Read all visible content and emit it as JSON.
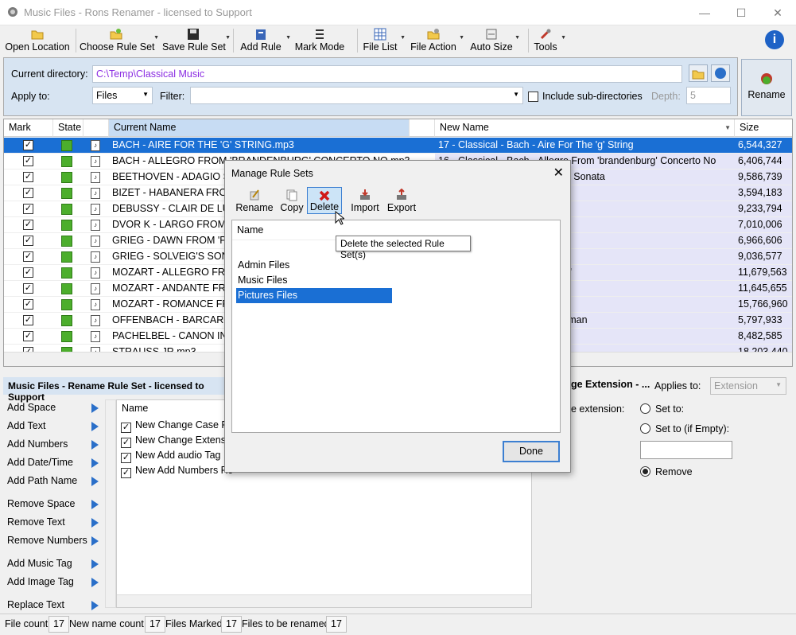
{
  "window": {
    "title": "Music Files - Rons Renamer - licensed to Support",
    "minimize": "—",
    "maximize": "☐",
    "close": "✕"
  },
  "toolbar": {
    "open_location": "Open Location",
    "choose_rule_set": "Choose Rule Set",
    "save_rule_set": "Save Rule Set",
    "add_rule": "Add Rule",
    "mark_mode": "Mark Mode",
    "file_list": "File List",
    "file_action": "File Action",
    "auto_size": "Auto Size",
    "tools": "Tools"
  },
  "top": {
    "current_directory_label": "Current directory:",
    "current_directory": "C:\\Temp\\Classical Music",
    "apply_to_label": "Apply to:",
    "apply_to": "Files",
    "filter_label": "Filter:",
    "filter": "",
    "include_sub_label": "Include sub-directories",
    "depth_label": "Depth:",
    "depth": "5",
    "rename_label": "Rename"
  },
  "grid": {
    "headers": {
      "mark": "Mark",
      "state": "State",
      "current": "Current Name",
      "new": "New Name",
      "size": "Size"
    },
    "rows": [
      {
        "current": "BACH - AIRE FOR THE 'G' STRING.mp3",
        "new": "17 - Classical - Bach - Aire For The 'g' String",
        "size": "6,544,327"
      },
      {
        "current": "BACH - ALLEGRO FROM 'BRANDENBURG' CONCERTO NO.mp3",
        "new": "16 - Classical - Bach - Allegro From 'brandenburg' Concerto No",
        "size": "6,406,744"
      },
      {
        "current": "BEETHOVEN - ADAGIO SOS",
        "new": "gio Sostenuto Form Moonlight Sonata",
        "size": "9,586,739"
      },
      {
        "current": "BIZET - HABANERA FROM '",
        "new": "From 'carmen'",
        "size": "3,594,183"
      },
      {
        "current": "DEBUSSY - CLAIR DE LUNE.",
        "new": "e Lune",
        "size": "9,233,794"
      },
      {
        "current": "DVOR K - LARGO FROM SY",
        "new": "om Symphony No",
        "size": "7,010,006"
      },
      {
        "current": "GRIEG - DAWN FROM 'PEER",
        "new": "m 'peer Gynt'",
        "size": "6,966,606"
      },
      {
        "current": "GRIEG - SOLVEIG'S SONG FR",
        "new": "Song From Peer Gynt",
        "size": "9,036,577"
      },
      {
        "current": "MOZART - ALLEGRO FROM",
        "new": "From 'eine Kleine Nachtmusik'",
        "size": "11,679,563"
      },
      {
        "current": "MOZART - ANDANTE FROM",
        "new": "e From Piano Concerto No",
        "size": "11,645,655"
      },
      {
        "current": "MOZART - ROMANCE FROM",
        "new": "ce From Piano Concerto No",
        "size": "15,766,960"
      },
      {
        "current": "OFFENBACH - BARCAROLL",
        "new": "arolle From The Tales Of Hoffman",
        "size": "5,797,933"
      },
      {
        "current": "PACHELBEL - CANON IN D.",
        "new": "n In D",
        "size": "8,482,585"
      },
      {
        "current": "STRAUSS JR.mp3",
        "new": "",
        "size": "18,203,440"
      }
    ]
  },
  "rules": {
    "title": "Music Files - Rename Rule Set - licensed to Support",
    "buttons": [
      "Add Space",
      "Add Text",
      "Add Numbers",
      "Add Date/Time",
      "Add Path Name",
      "Remove Space",
      "Remove Text",
      "Remove Numbers",
      "Add Music Tag",
      "Add Image Tag",
      "Replace Text"
    ],
    "list_header": "Name",
    "items": [
      "New Change Case Ru",
      "New Change Extensio",
      "New Add audio Tag R",
      "New Add Numbers Ru"
    ],
    "hidden_cols": "Add Numbers",
    "ext_title": "ge Extension - ...",
    "applies_to_label": "Applies to:",
    "applies_to": "Extension",
    "ext_label": "e extension:",
    "set_to": "Set to:",
    "set_to_empty": "Set to (if Empty):",
    "remove": "Remove"
  },
  "status": {
    "file_count_label": "File count",
    "file_count": "17",
    "new_name_label": "New name count",
    "new_name": "17",
    "marked_label": "Files Marked",
    "marked": "17",
    "to_rename_label": "Files to be renamed",
    "to_rename": "17"
  },
  "dialog": {
    "title": "Manage Rule Sets",
    "close": "✕",
    "rename": "Rename",
    "copy": "Copy",
    "delete": "Delete",
    "import": "Import",
    "export": "Export",
    "list_header": "Name",
    "items": [
      "Admin Files",
      "Music Files",
      "Pictures Files"
    ],
    "tooltip": "Delete the selected Rule Set(s)",
    "done": "Done"
  }
}
